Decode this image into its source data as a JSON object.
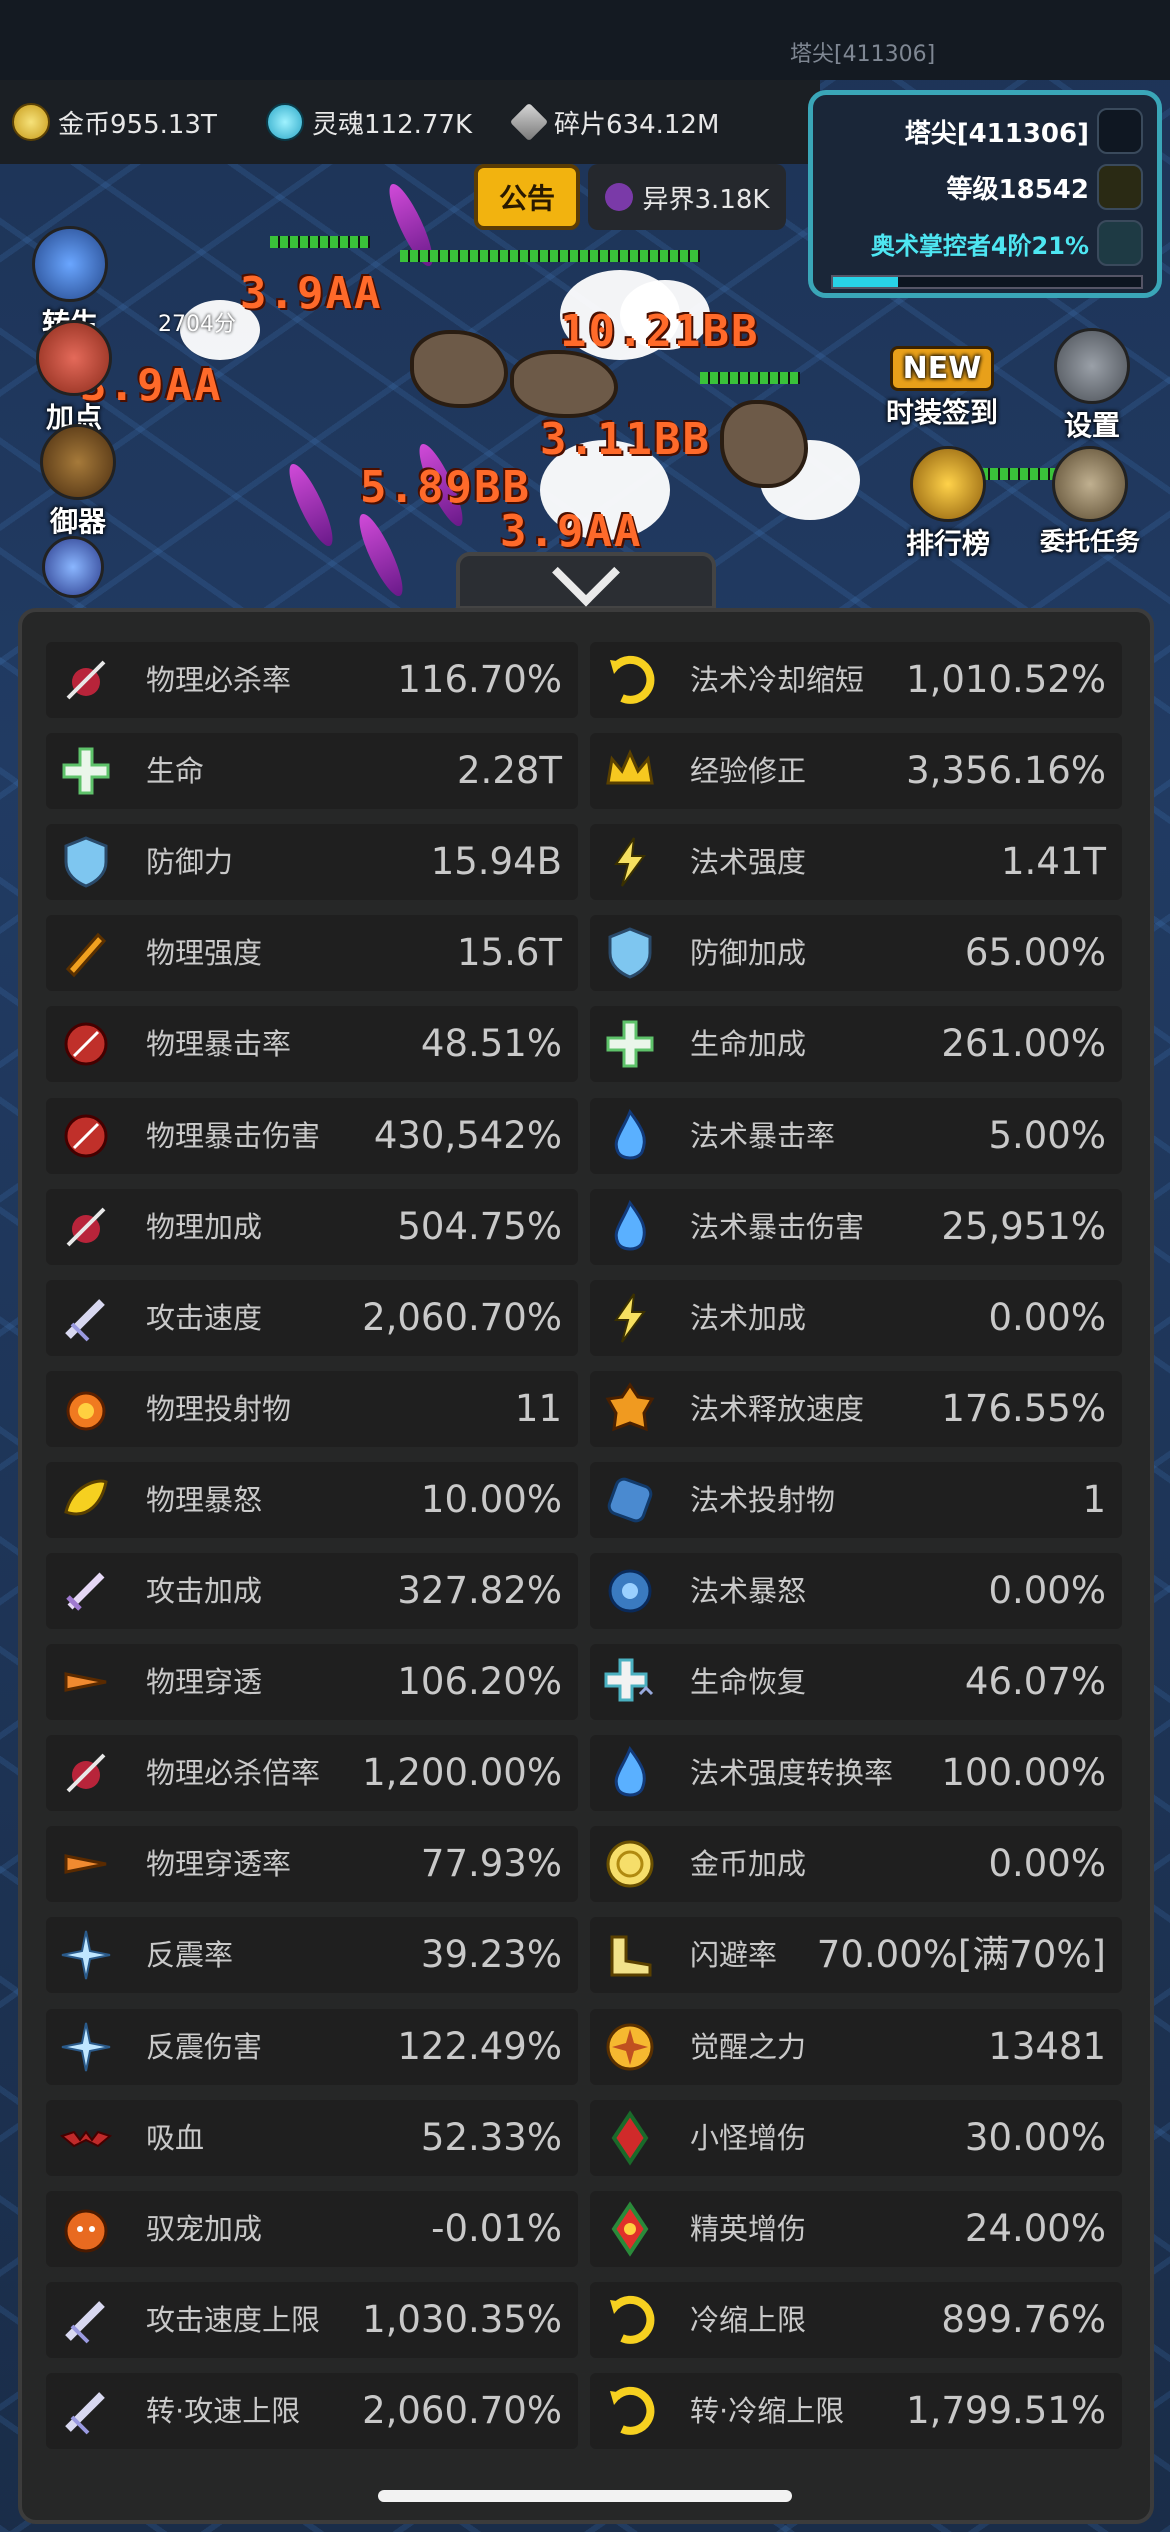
{
  "header": {
    "top_title": "塔尖[411306]"
  },
  "resources": [
    {
      "label": "金币955.13T",
      "icon": "gold-coin-icon"
    },
    {
      "label": "灵魂112.77K",
      "icon": "soul-icon"
    },
    {
      "label": "碎片634.12M",
      "icon": "fragment-icon"
    }
  ],
  "hud": {
    "tower": "塔尖[411306]",
    "level": "等级18542",
    "mastery": "奥术掌控者4阶21%",
    "mastery_progress": 0.21
  },
  "buttons": {
    "notice": "公告",
    "otherworld": "异界3.18K",
    "rebirth": "转生",
    "rebirth_sub": "2704分",
    "add_points": "加点",
    "guard": "御器",
    "fashion_checkin": "时装签到",
    "fashion_new": "NEW",
    "settings": "设置",
    "leaderboard": "排行榜",
    "quests": "委托任务"
  },
  "damage_numbers": [
    "3.9AA",
    "10.21BB",
    "3.9AA",
    "3.11BB",
    "5.89BB",
    "3.9AA"
  ],
  "stats": {
    "left": [
      {
        "label": "物理必杀率",
        "value": "116.70%",
        "icon": "kill-icon"
      },
      {
        "label": "生命",
        "value": "2.28T",
        "icon": "life-cross-icon"
      },
      {
        "label": "防御力",
        "value": "15.94B",
        "icon": "shield-icon"
      },
      {
        "label": "物理强度",
        "value": "15.6T",
        "icon": "fist-icon"
      },
      {
        "label": "物理暴击率",
        "value": "48.51%",
        "icon": "crit-icon"
      },
      {
        "label": "物理暴击伤害",
        "value": "430,542%",
        "icon": "crit-icon"
      },
      {
        "label": "物理加成",
        "value": "504.75%",
        "icon": "kill-icon"
      },
      {
        "label": "攻击速度",
        "value": "2,060.70%",
        "icon": "attack-speed-icon"
      },
      {
        "label": "物理投射物",
        "value": "11",
        "icon": "projectile-fire-icon"
      },
      {
        "label": "物理暴怒",
        "value": "10.00%",
        "icon": "rage-icon"
      },
      {
        "label": "攻击加成",
        "value": "327.82%",
        "icon": "sword-icon"
      },
      {
        "label": "物理穿透",
        "value": "106.20%",
        "icon": "pierce-icon"
      },
      {
        "label": "物理必杀倍率",
        "value": "1,200.00%",
        "icon": "kill-icon"
      },
      {
        "label": "物理穿透率",
        "value": "77.93%",
        "icon": "pierce-icon"
      },
      {
        "label": "反震率",
        "value": "39.23%",
        "icon": "thorns-icon"
      },
      {
        "label": "反震伤害",
        "value": "122.49%",
        "icon": "thorns-icon"
      },
      {
        "label": "吸血",
        "value": "52.33%",
        "icon": "bat-icon"
      },
      {
        "label": "驭宠加成",
        "value": "-0.01%",
        "icon": "pet-icon"
      },
      {
        "label": "攻击速度上限",
        "value": "1,030.35%",
        "icon": "attack-speed-icon"
      },
      {
        "label": "转·攻速上限",
        "value": "2,060.70%",
        "icon": "attack-speed-icon"
      }
    ],
    "right": [
      {
        "label": "法术冷却缩短",
        "value": "1,010.52%",
        "icon": "cooldown-icon"
      },
      {
        "label": "经验修正",
        "value": "3,356.16%",
        "icon": "crown-icon"
      },
      {
        "label": "法术强度",
        "value": "1.41T",
        "icon": "lightning-icon"
      },
      {
        "label": "防御加成",
        "value": "65.00%",
        "icon": "shield-icon"
      },
      {
        "label": "生命加成",
        "value": "261.00%",
        "icon": "life-cross-icon"
      },
      {
        "label": "法术暴击率",
        "value": "5.00%",
        "icon": "blue-flame-icon"
      },
      {
        "label": "法术暴击伤害",
        "value": "25,951%",
        "icon": "blue-flame-icon"
      },
      {
        "label": "法术加成",
        "value": "0.00%",
        "icon": "lightning-icon"
      },
      {
        "label": "法术释放速度",
        "value": "176.55%",
        "icon": "cast-speed-icon"
      },
      {
        "label": "法术投射物",
        "value": "1",
        "icon": "spell-projectile-icon"
      },
      {
        "label": "法术暴怒",
        "value": "0.00%",
        "icon": "spell-rage-icon"
      },
      {
        "label": "生命恢复",
        "value": "46.07%",
        "icon": "regen-icon"
      },
      {
        "label": "法术强度转换率",
        "value": "100.00%",
        "icon": "blue-flame-icon"
      },
      {
        "label": "金币加成",
        "value": "0.00%",
        "icon": "gold-coin-icon"
      },
      {
        "label": "闪避率",
        "value": "70.00%[满70%]",
        "icon": "boot-icon"
      },
      {
        "label": "觉醒之力",
        "value": "13481",
        "icon": "awaken-icon"
      },
      {
        "label": "小怪增伤",
        "value": "30.00%",
        "icon": "minion-damage-icon"
      },
      {
        "label": "精英增伤",
        "value": "24.00%",
        "icon": "elite-damage-icon"
      },
      {
        "label": "冷缩上限",
        "value": "899.76%",
        "icon": "cooldown-icon"
      },
      {
        "label": "转·冷缩上限",
        "value": "1,799.51%",
        "icon": "cooldown-icon"
      }
    ]
  },
  "colors": {
    "panel_bg": "#262727",
    "row_bg": "#1f1f1f",
    "text": "#c9c9c9",
    "damage": "#ff6a2a",
    "accent_cyan": "#28d2e6",
    "notice_yellow": "#f2b30f"
  }
}
